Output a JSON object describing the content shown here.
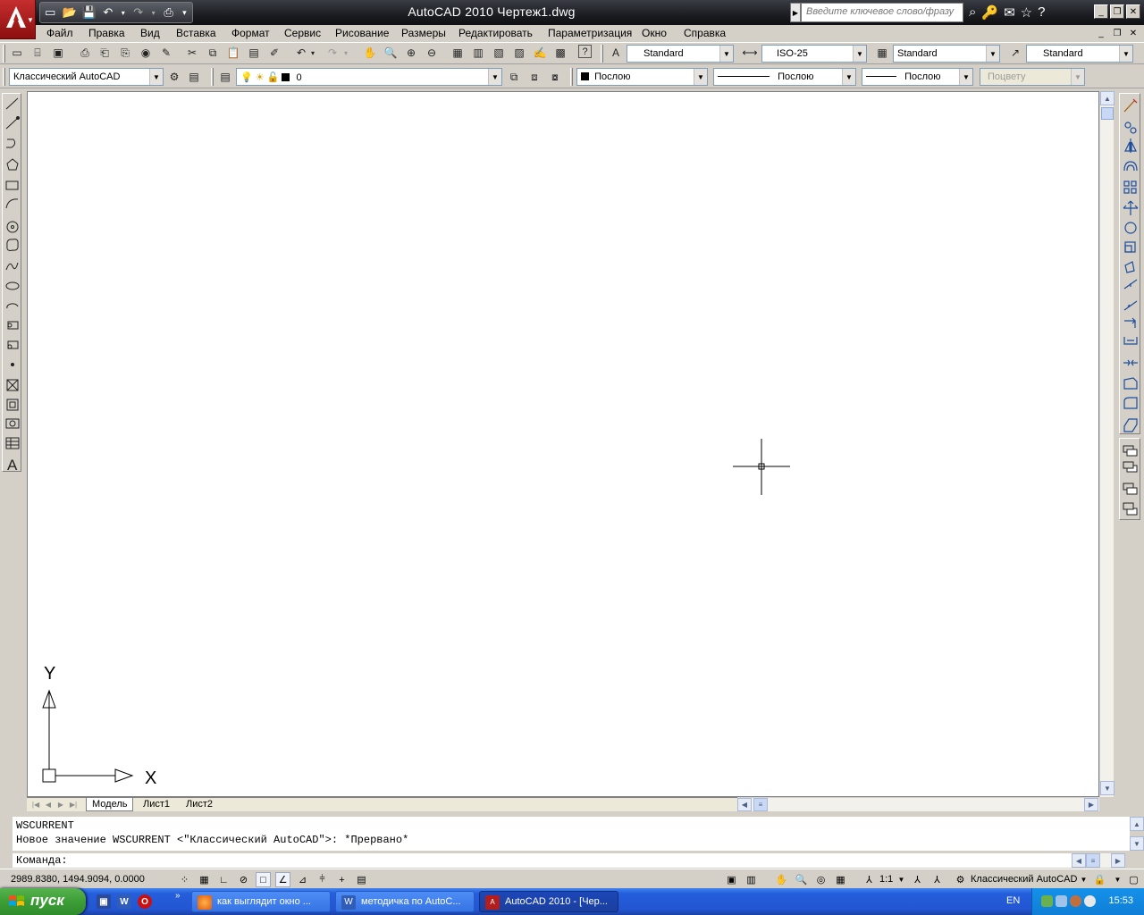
{
  "title_bar": {
    "title": "AutoCAD 2010    Чертеж1.dwg",
    "search_placeholder": "Введите ключевое слово/фразу"
  },
  "menu": [
    "Файл",
    "Правка",
    "Вид",
    "Вставка",
    "Формат",
    "Сервис",
    "Рисование",
    "Размеры",
    "Редактировать",
    "Параметризация",
    "Окно",
    "Справка"
  ],
  "styles_toolbar": {
    "text_style": "Standard",
    "dim_style": "ISO-25",
    "table_style": "Standard",
    "mleader_style": "Standard"
  },
  "workspace_toolbar": {
    "workspace": "Классический AutoCAD"
  },
  "layers_toolbar": {
    "current_layer": "0"
  },
  "properties_toolbar": {
    "color": "Послою",
    "linetype": "Послою",
    "lineweight": "Послою",
    "plot_style": "Поцвету"
  },
  "ucs": {
    "x_label": "X",
    "y_label": "Y"
  },
  "layout_tabs": [
    "Модель",
    "Лист1",
    "Лист2"
  ],
  "active_layout": "Модель",
  "command_window": {
    "history": [
      "WSCURRENT",
      "Новое значение WSCURRENT <\"Классический AutoCAD\">: *Прервано*"
    ],
    "prompt": "Команда:"
  },
  "status_bar": {
    "coordinates": "2989.8380, 1494.9094, 0.0000",
    "annotation_scale": "1:1",
    "workspace": "Классический AutoCAD"
  },
  "taskbar": {
    "start_label": "пуск",
    "tasks": [
      "как выглядит окно ...",
      "методичка по AutoC...",
      "AutoCAD 2010 - [Чер..."
    ],
    "active_task_index": 2,
    "language": "EN",
    "clock": "15:53"
  },
  "colors": {
    "title_bar": "#1c1d22",
    "app_button": "#b11e1e",
    "toolbar_bg": "#d4d0c8",
    "canvas": "#ffffff",
    "taskbar": "#245edb",
    "start_button": "#3c9e37"
  }
}
